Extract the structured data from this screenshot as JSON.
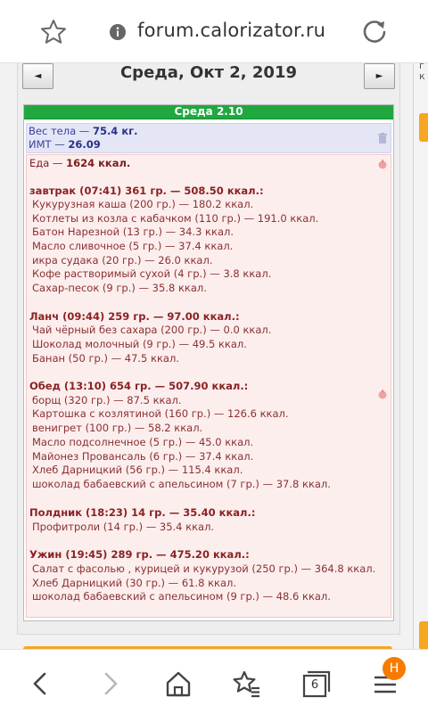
{
  "browser": {
    "url": "forum.calorizator.ru",
    "tabs_count": "6",
    "profile_badge": "H"
  },
  "nav": {
    "date": "Среда, Окт 2, 2019",
    "prev": "◄",
    "next": "►"
  },
  "day": {
    "header": "Среда 2.10",
    "weight_label": "Вес тела —",
    "weight_value": "75.4 кг.",
    "bmi_label": "ИМТ —",
    "bmi_value": "26.09",
    "food_label": "Еда —",
    "food_value": "1624 ккал.",
    "meals": [
      {
        "title": "завтрак (07:41) 361 гр. — 508.50 ккал.:",
        "items": [
          "Кукурузная каша (200 гр.) — 180.2 ккал.",
          "Котлеты из козла с кабачком (110 гр.) — 191.0 ккал.",
          "Батон Нарезной (13 гр.) — 34.3 ккал.",
          "Масло сливочное (5 гр.) — 37.4 ккал.",
          "икра судака (20 гр.) — 26.0 ккал.",
          "Кофе растворимый сухой (4 гр.) — 3.8 ккал.",
          "Сахар-песок (9 гр.) — 35.8 ккал."
        ]
      },
      {
        "title": "Ланч (09:44) 259 гр. — 97.00 ккал.:",
        "items": [
          "Чай чёрный без сахара (200 гр.) — 0.0 ккал.",
          "Шоколад молочный (9 гр.) — 49.5 ккал.",
          "Банан (50 гр.) — 47.5 ккал."
        ]
      },
      {
        "title": "Обед (13:10) 654 гр. — 507.90 ккал.:",
        "items": [
          "борщ (320 гр.) — 87.5 ккал.",
          "Картошка с козлятиной (160 гр.) — 126.6 ккал.",
          "венигрет (100 гр.) — 58.2 ккал.",
          "Масло подсолнечное (5 гр.) — 45.0 ккал.",
          "Майонез Провансаль (6 гр.) — 37.4 ккал.",
          "Хлеб Дарницкий (56 гр.) — 115.4 ккал.",
          "шоколад бабаевский с апельсином (7 гр.) — 37.8 ккал."
        ]
      },
      {
        "title": "Полдник (18:23) 14 гр. — 35.40 ккал.:",
        "items": [
          "Профитроли (14 гр.) — 35.4 ккал."
        ]
      },
      {
        "title": "Ужин (19:45) 289 гр. — 475.20 ккал.:",
        "items": [
          "Салат с фасолью , курицей и кукурузой (250 гр.) — 364.8 ккал.",
          "Хлеб Дарницкий (30 гр.) — 61.8 ккал.",
          "шоколад бабаевский с апельсином (9 гр.) — 48.6 ккал."
        ]
      }
    ]
  },
  "right_panel_text": [
    "г",
    "к"
  ],
  "colors": {
    "header_green": "#20a840",
    "food_bg": "#fdeeee",
    "weight_bg": "#e4e6f5",
    "accent_orange": "#f5a623"
  },
  "icons": [
    "favorite-star-icon",
    "site-info-icon",
    "reload-icon",
    "trash-icon",
    "apple-icon",
    "back-icon",
    "forward-icon",
    "home-icon",
    "bookmarks-icon",
    "tabs-icon",
    "menu-icon"
  ]
}
